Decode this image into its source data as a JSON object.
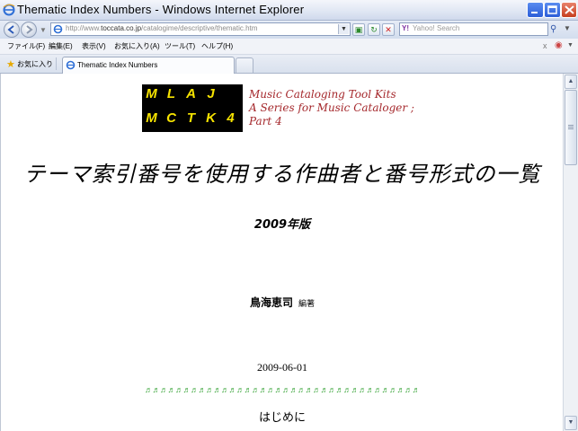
{
  "window": {
    "title": "Thematic Index Numbers - Windows Internet Explorer"
  },
  "address_bar": {
    "url_prefix": "http://www.",
    "url_domain": "toccata.co.jp",
    "url_path": "/catalogime/descriptive/thematic.htm"
  },
  "search": {
    "placeholder": "Yahoo! Search"
  },
  "menu": {
    "items": [
      "ファイル(F)",
      "編集(E)",
      "表示(V)",
      "お気に入り(A)",
      "ツール(T)",
      "ヘルプ(H)"
    ]
  },
  "favorites": {
    "label": "お気に入り"
  },
  "tab": {
    "label": "Thematic Index Numbers"
  },
  "page": {
    "logo": {
      "row1": [
        "M",
        "L",
        "A",
        "J"
      ],
      "row2": [
        "M",
        "C",
        "T",
        "K",
        "4"
      ]
    },
    "series": {
      "line1": "Music Cataloging Tool Kits",
      "line2": "A Series for Music Cataloger ;",
      "line3": "Part 4"
    },
    "title": "テーマ索引番号を使用する作曲者と番号形式の一覧",
    "edition": "2009年版",
    "author": "鳥海恵司",
    "author_role": "編著",
    "date": "2009-06-01",
    "notes_divider": "♬♬♬♬♬♬♬♬♬♬♬♬♬♬♬♬♬♬♬♬♬♬♬♬♬♬♬♬♬♬♬♬♬♬♬♬",
    "intro_heading": "はじめに"
  },
  "colors": {
    "logo_background": "#000000",
    "logo_letters": "#f6e300",
    "series_text": "#a5282c",
    "notes_divider": "#3aa53a"
  }
}
